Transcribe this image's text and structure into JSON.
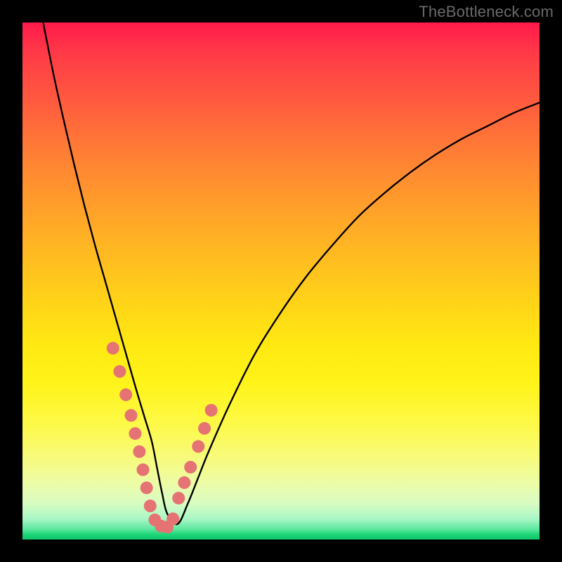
{
  "watermark": {
    "text": "TheBottleneck.com"
  },
  "chart_data": {
    "type": "line",
    "title": "",
    "xlabel": "",
    "ylabel": "",
    "xlim": [
      0,
      100
    ],
    "ylim": [
      0,
      100
    ],
    "grid": false,
    "legend": false,
    "background_gradient": "top: red → yellow → green (bottom)",
    "series": [
      {
        "name": "curve",
        "type": "line",
        "color": "#000000",
        "x": [
          4,
          6,
          8,
          10,
          12,
          14,
          16,
          18,
          20,
          22,
          23.5,
          25,
          26,
          27,
          28,
          30,
          32,
          34,
          36,
          40,
          45,
          50,
          55,
          60,
          65,
          70,
          75,
          80,
          85,
          90,
          95,
          100
        ],
        "y": [
          100,
          90,
          81,
          72.5,
          64.5,
          57,
          50,
          43,
          36,
          29,
          24,
          19,
          14,
          9,
          5,
          3,
          7,
          12,
          17,
          26,
          36,
          44,
          51,
          57,
          62.5,
          67,
          71,
          74.5,
          77.5,
          80,
          82.5,
          84.5
        ]
      },
      {
        "name": "markers-left",
        "type": "scatter",
        "color": "#e57373",
        "radius": 9,
        "x": [
          17.5,
          18.8,
          20.0,
          21.0,
          21.8,
          22.6,
          23.3,
          24.0,
          24.7
        ],
        "y": [
          37.0,
          32.5,
          28.0,
          24.0,
          20.5,
          17.0,
          13.5,
          10.0,
          6.5
        ]
      },
      {
        "name": "markers-right",
        "type": "scatter",
        "color": "#e57373",
        "radius": 9,
        "x": [
          30.2,
          31.3,
          32.5,
          34.0,
          35.2,
          36.5
        ],
        "y": [
          8.0,
          11.0,
          14.0,
          18.0,
          21.5,
          25.0
        ]
      },
      {
        "name": "markers-bottom",
        "type": "scatter",
        "color": "#e57373",
        "radius": 9,
        "x": [
          25.6,
          26.8,
          28.0,
          29.1
        ],
        "y": [
          3.8,
          2.6,
          2.4,
          4.0
        ]
      }
    ]
  }
}
